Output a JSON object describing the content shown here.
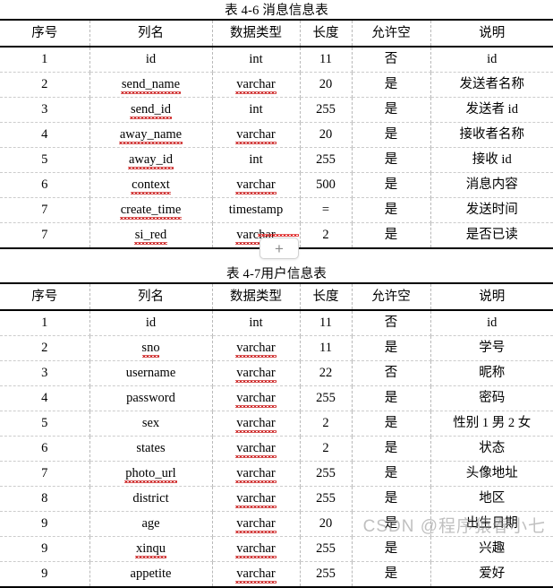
{
  "columns": {
    "headers": [
      "序号",
      "列名",
      "数据类型",
      "长度",
      "允许空",
      "说明"
    ]
  },
  "table1": {
    "title": "表 4-6 消息信息表",
    "rows": [
      [
        "1",
        "id",
        "int",
        "11",
        "否",
        "id"
      ],
      [
        "2",
        "send_name",
        "varchar",
        "20",
        "是",
        "发送者名称"
      ],
      [
        "3",
        "send_id",
        "int",
        "255",
        "是",
        "发送者 id"
      ],
      [
        "4",
        "away_name",
        "varchar",
        "20",
        "是",
        "接收者名称"
      ],
      [
        "5",
        "away_id",
        "int",
        "255",
        "是",
        "接收 id"
      ],
      [
        "6",
        "context",
        "varchar",
        "500",
        "是",
        "消息内容"
      ],
      [
        "7",
        "create_time",
        "timestamp",
        "=",
        "是",
        "发送时间"
      ],
      [
        "7",
        "si_red",
        "varchar",
        "2",
        "是",
        "是否已读"
      ]
    ]
  },
  "table2": {
    "title_prefix": "表 4-7",
    "title_hidden": "用户",
    "title_suffix": "信息表",
    "rows": [
      [
        "1",
        "id",
        "int",
        "11",
        "否",
        "id"
      ],
      [
        "2",
        "sno",
        "varchar",
        "11",
        "是",
        "学号"
      ],
      [
        "3",
        "username",
        "varchar",
        "22",
        "否",
        "昵称"
      ],
      [
        "4",
        "password",
        "varchar",
        "255",
        "是",
        "密码"
      ],
      [
        "5",
        "sex",
        "varchar",
        "2",
        "是",
        "性别 1 男 2 女"
      ],
      [
        "6",
        "states",
        "varchar",
        "2",
        "是",
        "状态"
      ],
      [
        "7",
        "photo_url",
        "varchar",
        "255",
        "是",
        "头像地址"
      ],
      [
        "8",
        "district",
        "varchar",
        "255",
        "是",
        "地区"
      ],
      [
        "9",
        "age",
        "varchar",
        "20",
        "是",
        "出生日期"
      ],
      [
        "9",
        "xinqu",
        "varchar",
        "255",
        "是",
        "兴趣"
      ],
      [
        "9",
        "appetite",
        "varchar",
        "255",
        "是",
        "爱好"
      ]
    ]
  },
  "overlay": {
    "plus_label": "+"
  },
  "watermark": {
    "text": "CSDN @程序猿春小七"
  },
  "spellcheck_cells": {
    "table1": [
      [
        1,
        1
      ],
      [
        1,
        2
      ],
      [
        2,
        1
      ],
      [
        3,
        1
      ],
      [
        3,
        2
      ],
      [
        4,
        1
      ],
      [
        5,
        1
      ],
      [
        5,
        2
      ],
      [
        6,
        1
      ],
      [
        7,
        1
      ],
      [
        7,
        2
      ]
    ],
    "table2": [
      [
        1,
        1
      ],
      [
        1,
        2
      ],
      [
        2,
        2
      ],
      [
        3,
        2
      ],
      [
        4,
        2
      ],
      [
        5,
        2
      ],
      [
        6,
        1
      ],
      [
        6,
        2
      ],
      [
        7,
        2
      ],
      [
        8,
        2
      ],
      [
        9,
        1
      ],
      [
        9,
        2
      ],
      [
        10,
        2
      ]
    ]
  }
}
